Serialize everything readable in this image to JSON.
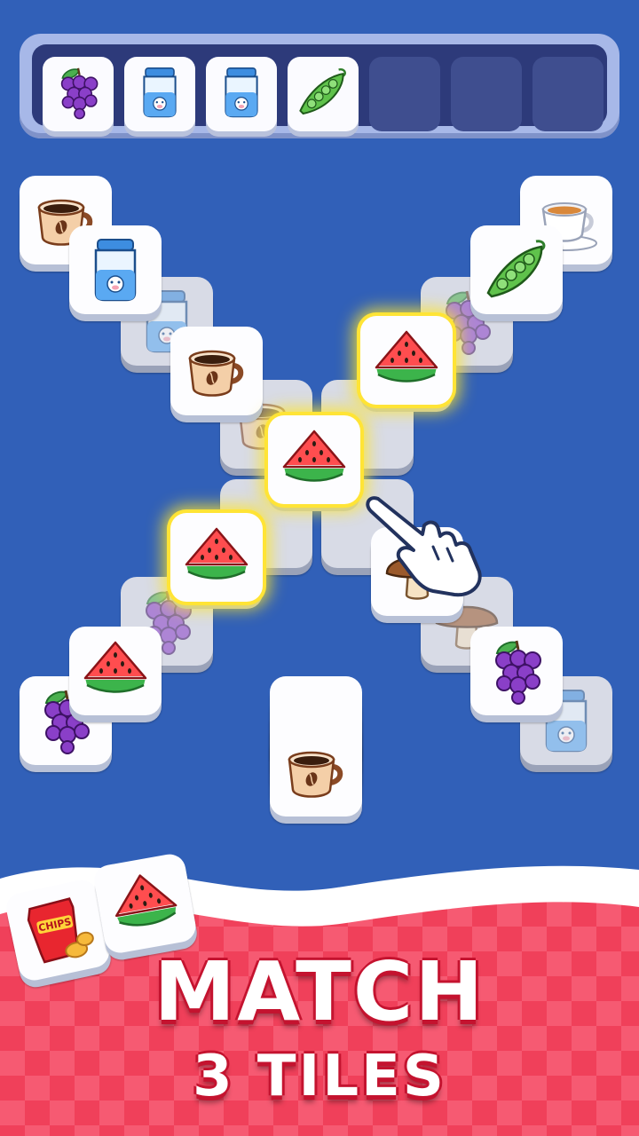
{
  "tray": {
    "slots": [
      "grapes-icon",
      "milk-jar-icon",
      "milk-jar-icon",
      "peas-icon",
      "empty",
      "empty",
      "empty"
    ]
  },
  "board": {
    "tiles": [
      {
        "icon": "coffee-cup-icon",
        "state": "normal"
      },
      {
        "icon": "milk-jar-icon",
        "state": "normal"
      },
      {
        "icon": "milk-jar-icon",
        "state": "dim"
      },
      {
        "icon": "coffee-cup-icon",
        "state": "normal"
      },
      {
        "icon": "tea-cup-icon",
        "state": "normal"
      },
      {
        "icon": "peas-icon",
        "state": "normal"
      },
      {
        "icon": "grapes-icon",
        "state": "dim"
      },
      {
        "icon": "watermelon-icon",
        "state": "highlighted"
      },
      {
        "icon": "watermelon-icon",
        "state": "highlighted"
      },
      {
        "icon": "watermelon-icon",
        "state": "highlighted"
      },
      {
        "icon": "mushroom-icon",
        "state": "normal"
      },
      {
        "icon": "mushroom-icon",
        "state": "dim"
      },
      {
        "icon": "grapes-icon",
        "state": "dim"
      },
      {
        "icon": "watermelon-icon",
        "state": "normal"
      },
      {
        "icon": "grapes-icon",
        "state": "normal"
      },
      {
        "icon": "grapes-icon",
        "state": "normal"
      },
      {
        "icon": "milk-jar-icon",
        "state": "normal"
      },
      {
        "icon": "coffee-cup-icon",
        "state": "normal"
      }
    ]
  },
  "banner": {
    "headline": "MATCH",
    "subline": "3 TILES",
    "chips_label": "CHIPS"
  },
  "colors": {
    "background": "#3160b8",
    "highlight": "#ffe436",
    "banner_red": "#e8384f"
  }
}
